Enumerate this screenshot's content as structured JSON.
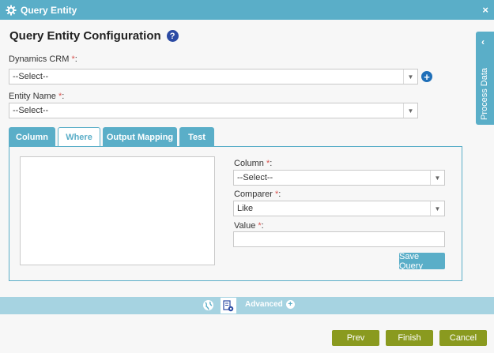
{
  "window": {
    "title": "Query Entity",
    "close_glyph": "×"
  },
  "heading": {
    "text": "Query Entity Configuration",
    "help_glyph": "?"
  },
  "dynamics_crm": {
    "label": "Dynamics CRM",
    "required": "*",
    "colon": ":",
    "value": "--Select--"
  },
  "entity_name": {
    "label": "Entity Name",
    "required": "*",
    "colon": ":",
    "value": "--Select--"
  },
  "side_panel": {
    "label": "Process Data",
    "chevron": "‹"
  },
  "tabs": [
    {
      "label": "Column"
    },
    {
      "label": "Where"
    },
    {
      "label": "Output Mapping"
    },
    {
      "label": "Test"
    }
  ],
  "where_panel": {
    "column_label": "Column",
    "column_value": "--Select--",
    "comparer_label": "Comparer",
    "comparer_value": "Like",
    "value_label": "Value",
    "required": "*",
    "colon": ":",
    "save_label": "Save Query"
  },
  "footer": {
    "advanced_label": "Advanced"
  },
  "actions": {
    "prev": "Prev",
    "finish": "Finish",
    "cancel": "Cancel"
  },
  "icons": {
    "title": "gear-icon",
    "help": "help-icon",
    "add": "plus-circle-icon",
    "side": "chevron-left-icon",
    "globe": "globe-icon",
    "doc": "document-settings-icon",
    "advanced": "plus-icon",
    "dropdown": "dropdown-arrow-icon"
  },
  "colors": {
    "accent": "#5aaec8",
    "action": "#8a9a1f",
    "required": "#d9534f",
    "help": "#2b4aa3"
  }
}
